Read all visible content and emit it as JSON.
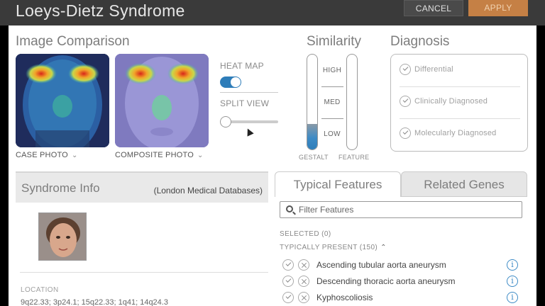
{
  "header": {
    "title": "Loeys-Dietz Syndrome",
    "cancel_label": "CANCEL",
    "apply_label": "APPLY"
  },
  "comparison": {
    "heading": "Image Comparison",
    "case_photo_label": "CASE PHOTO",
    "composite_photo_label": "COMPOSITE PHOTO",
    "heat_map_label": "HEAT MAP",
    "heat_map_on": true,
    "split_view_label": "SPLIT VIEW",
    "split_view_value": 0
  },
  "similarity": {
    "heading": "Similarity",
    "levels": [
      "HIGH",
      "MED",
      "LOW"
    ],
    "gestalt_label": "GESTALT",
    "feature_label": "FEATURE",
    "gestalt_fraction": 0.27,
    "feature_fraction": 0,
    "fill_color": "#2e7db9"
  },
  "diagnosis": {
    "heading": "Diagnosis",
    "options": [
      "Differential",
      "Clinically Diagnosed",
      "Molecularly Diagnosed"
    ]
  },
  "syndrome_info": {
    "heading": "Syndrome Info",
    "source": "(London Medical Databases)",
    "location_label": "LOCATION",
    "location_value": "9q22.33; 3p24.1; 15q22.33; 1q41; 14q24.3"
  },
  "tabs": {
    "active": "Typical Features",
    "inactive": "Related Genes"
  },
  "features": {
    "filter_placeholder": "Filter Features",
    "selected_label": "SELECTED (0)",
    "typically_present_label": "TYPICALLY PRESENT (150)",
    "items": [
      "Ascending tubular aorta aneurysm",
      "Descending thoracic aorta aneurysm",
      "Kyphoscoliosis"
    ]
  },
  "colors": {
    "accent_blue": "#2e7db9",
    "apply_orange": "#c58045",
    "header_bg": "#3a3a3a"
  }
}
